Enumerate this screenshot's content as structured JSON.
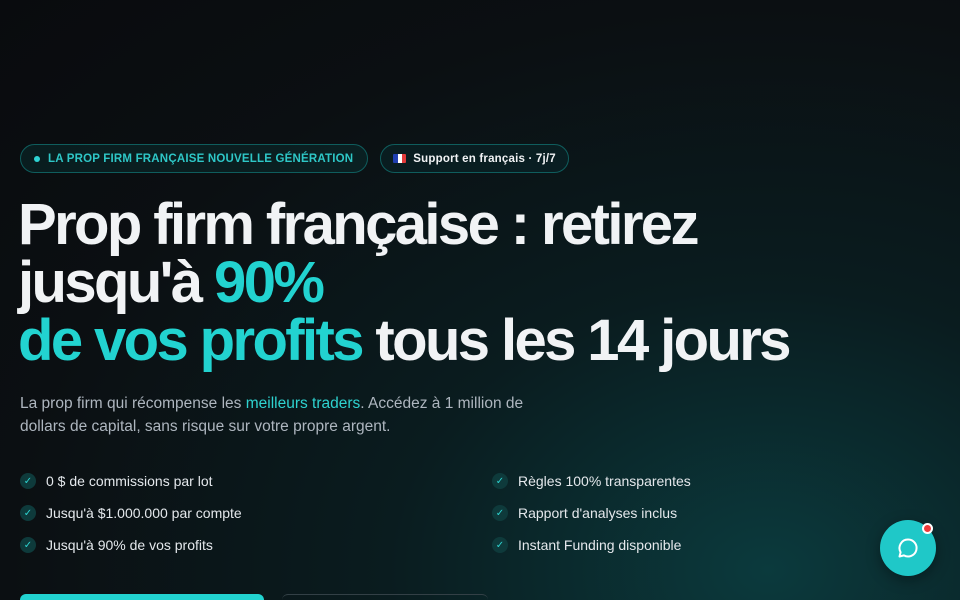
{
  "badges": {
    "primary": "LA PROP FIRM FRANÇAISE NOUVELLE GÉNÉRATION",
    "secondary": "Support en français · 7j/7"
  },
  "headline": {
    "part1": "Prop firm française : retirez",
    "part2": "jusqu'à ",
    "highlight1": "90%",
    "highlight2": "de vos profits",
    "part3": " tous les 14 jours"
  },
  "lede": {
    "before": "La prop firm qui récompense les ",
    "highlight": "meilleurs traders",
    "after": ". Accédez à 1 million de dollars de capital, sans risque sur votre propre argent."
  },
  "features": {
    "left": [
      "0 $ de commissions par lot",
      "Jusqu'à $1.000.000 par compte",
      "Jusqu'à 90% de vos profits"
    ],
    "right": [
      "Règles 100% transparentes",
      "Rapport d'analyses inclus",
      "Instant Funding disponible"
    ]
  },
  "icons": {
    "check": "check-icon",
    "flag": "france-flag-icon",
    "chat": "chat-bubble-icon"
  },
  "colors": {
    "accent": "#22d3d0",
    "background": "#0b0f12",
    "notification": "#ef3b3b"
  }
}
